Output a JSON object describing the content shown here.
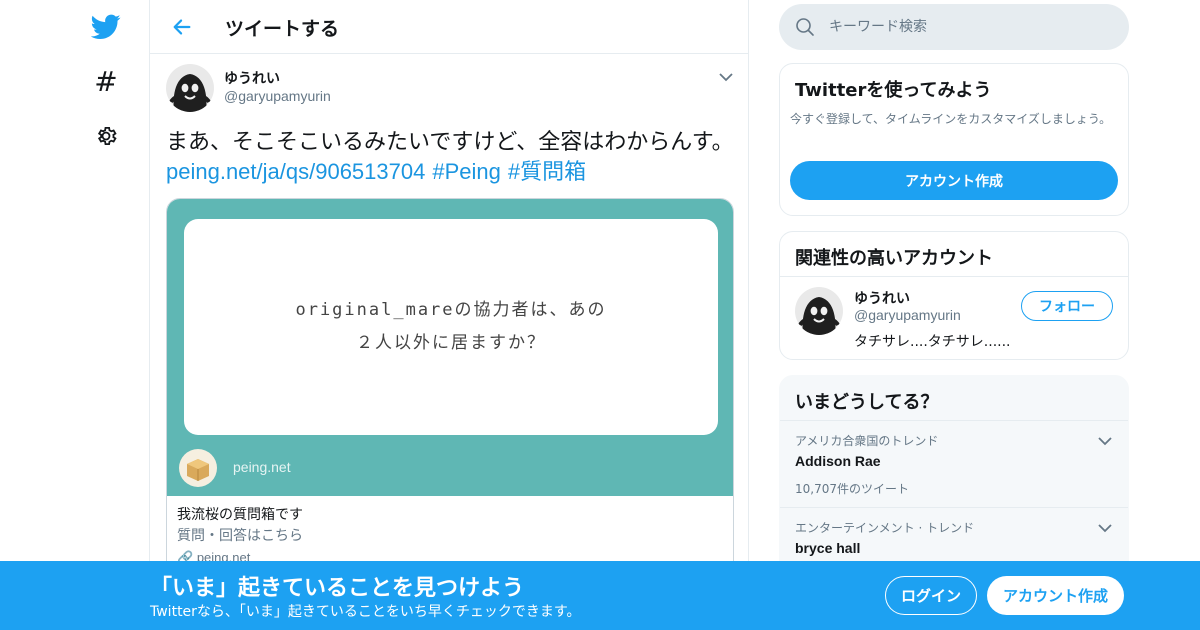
{
  "colors": {
    "brand": "#1da1f2",
    "link": "#1b95e0",
    "card_bg": "#5fb7b4"
  },
  "nav": {
    "icons": [
      "twitter-bird-icon",
      "hashtag-icon",
      "gear-icon"
    ],
    "hash_glyph": "#"
  },
  "header": {
    "title": "ツイートする"
  },
  "tweet": {
    "author_name": "ゆうれい",
    "author_handle": "@garyupamyurin",
    "text": "まあ、そこそこいるみたいですけど、全容はわからんす。",
    "link": "peing.net/ja/qs/906513704",
    "hashtag1": "#Peing",
    "hashtag2": "#質問箱",
    "card": {
      "question_line1": "original_mareの協力者は、あの",
      "question_line2": "２人以外に居ますか？",
      "brand": "peing.net",
      "title": "我流桜の質問箱です",
      "description": "質問・回答はこちら",
      "domain": "peing.net"
    }
  },
  "search": {
    "placeholder": "キーワード検索"
  },
  "signup_box": {
    "title": "Twitterを使ってみよう",
    "description": "今すぐ登録して、タイムラインをカスタマイズしましょう。",
    "button": "アカウント作成"
  },
  "related": {
    "title": "関連性の高いアカウント",
    "name": "ゆうれい",
    "handle": "@garyupamyurin",
    "bio": "タチサレ....タチサレ......",
    "follow": "フォロー"
  },
  "trends": {
    "title": "いまどうしてる？",
    "items": [
      {
        "context": "アメリカ合衆国のトレンド",
        "name": "Addison Rae",
        "count": "10,707件のツイート"
      },
      {
        "context": "エンターテインメント · トレンド",
        "name": "bryce hall",
        "count": ""
      }
    ]
  },
  "bottom_bar": {
    "title": "「いま」起きていることを見つけよう",
    "subtitle": "Twitterなら、「いま」起きていることをいち早くチェックできます。",
    "login": "ログイン",
    "signup": "アカウント作成"
  }
}
